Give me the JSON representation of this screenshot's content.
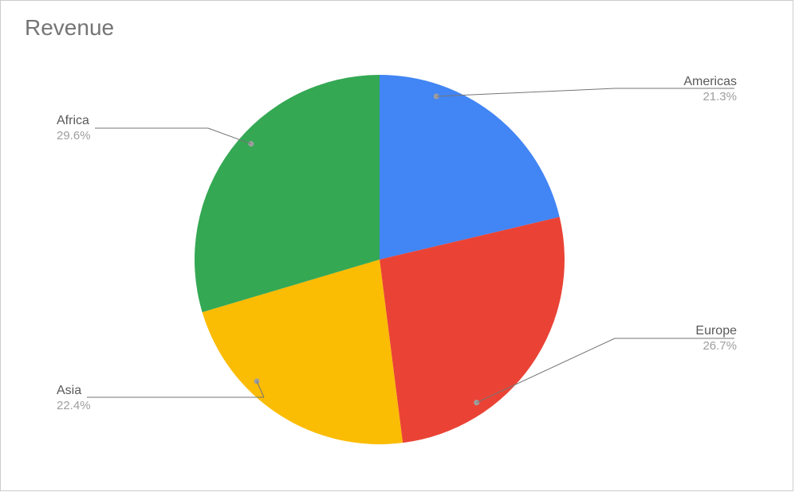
{
  "chart_data": {
    "type": "pie",
    "title": "Revenue",
    "series": [
      {
        "name": "Americas",
        "value": 21.3,
        "color": "#4285F4"
      },
      {
        "name": "Europe",
        "value": 26.7,
        "color": "#EA4335"
      },
      {
        "name": "Asia",
        "value": 22.4,
        "color": "#FBBC04"
      },
      {
        "name": "Africa",
        "value": 29.6,
        "color": "#34A853"
      }
    ]
  }
}
